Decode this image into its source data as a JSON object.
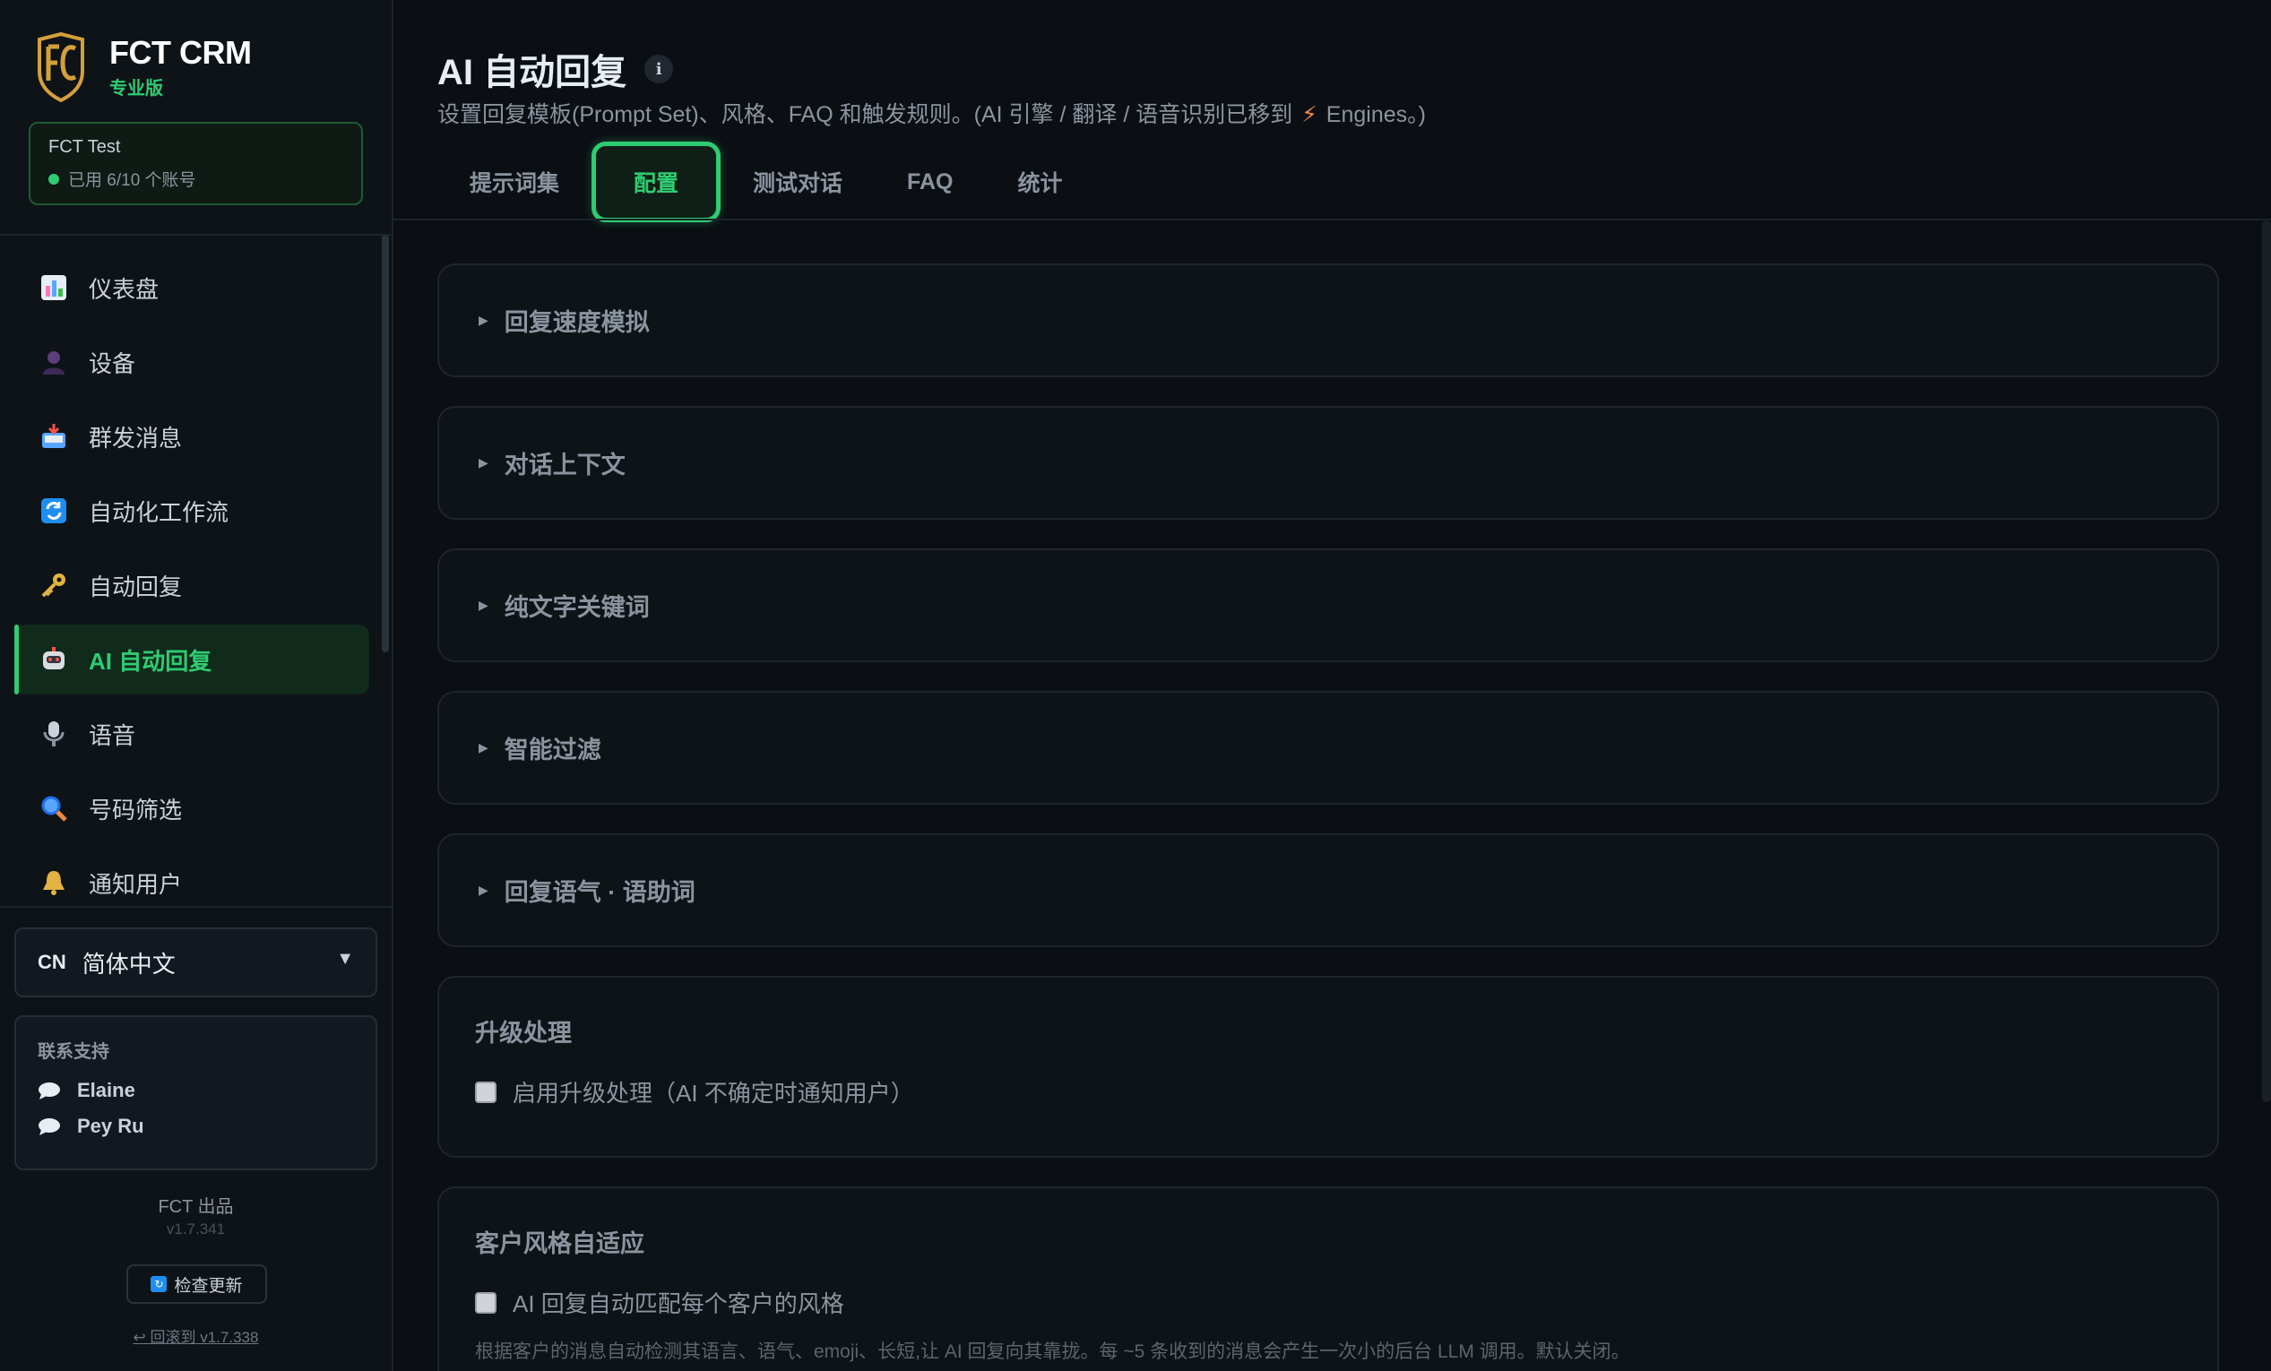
{
  "brand": {
    "name": "FCT CRM",
    "plan": "专业版"
  },
  "org": {
    "name": "FCT Test",
    "usage": "已用 6/10 个账号"
  },
  "nav": {
    "items": [
      {
        "label": "仪表盘",
        "icon": "bar-chart-icon"
      },
      {
        "label": "设备",
        "icon": "user-icon"
      },
      {
        "label": "群发消息",
        "icon": "inbox-icon"
      },
      {
        "label": "自动化工作流",
        "icon": "refresh-icon"
      },
      {
        "label": "自动回复",
        "icon": "key-icon"
      },
      {
        "label": "AI 自动回复",
        "icon": "robot-icon",
        "active": true
      },
      {
        "label": "语音",
        "icon": "microphone-icon"
      },
      {
        "label": "号码筛选",
        "icon": "magnifier-icon"
      },
      {
        "label": "通知用户",
        "icon": "bell-icon"
      }
    ]
  },
  "language": {
    "code": "CN",
    "label": "简体中文"
  },
  "support": {
    "title": "联系支持",
    "contacts": [
      "Elaine",
      "Pey Ru"
    ]
  },
  "footer": {
    "credit": "FCT 出品",
    "version": "v1.7.341",
    "update_button": "检查更新",
    "rollback": "↩ 回滚到 v1.7.338"
  },
  "page": {
    "title": "AI 自动回复",
    "subtitle_pre": "设置回复模板(Prompt Set)、风格、FAQ 和触发规则。(AI 引擎 / 翻译 / 语音识别已移到",
    "subtitle_post": "Engines。)"
  },
  "tabs": [
    "提示词集",
    "配置",
    "测试对话",
    "FAQ",
    "统计"
  ],
  "active_tab": "配置",
  "sections": [
    {
      "title": "回复速度模拟"
    },
    {
      "title": "对话上下文"
    },
    {
      "title": "纯文字关键词"
    },
    {
      "title": "智能过滤"
    },
    {
      "title": "回复语气 · 语助词"
    }
  ],
  "escalation": {
    "title": "升级处理",
    "checkbox_label": "启用升级处理（AI 不确定时通知用户）",
    "checked": false
  },
  "style_adapt": {
    "title": "客户风格自适应",
    "checkbox_label": "AI 回复自动匹配每个客户的风格",
    "checked": false,
    "description": "根据客户的消息自动检测其语言、语气、emoji、长短,让 AI 回复向其靠拢。每 ~5 条收到的消息会产生一次小的后台 LLM 调用。默认关闭。"
  },
  "colors": {
    "accent": "#2ecc71",
    "background": "#0b0f14",
    "sidebar": "#0e1318"
  }
}
